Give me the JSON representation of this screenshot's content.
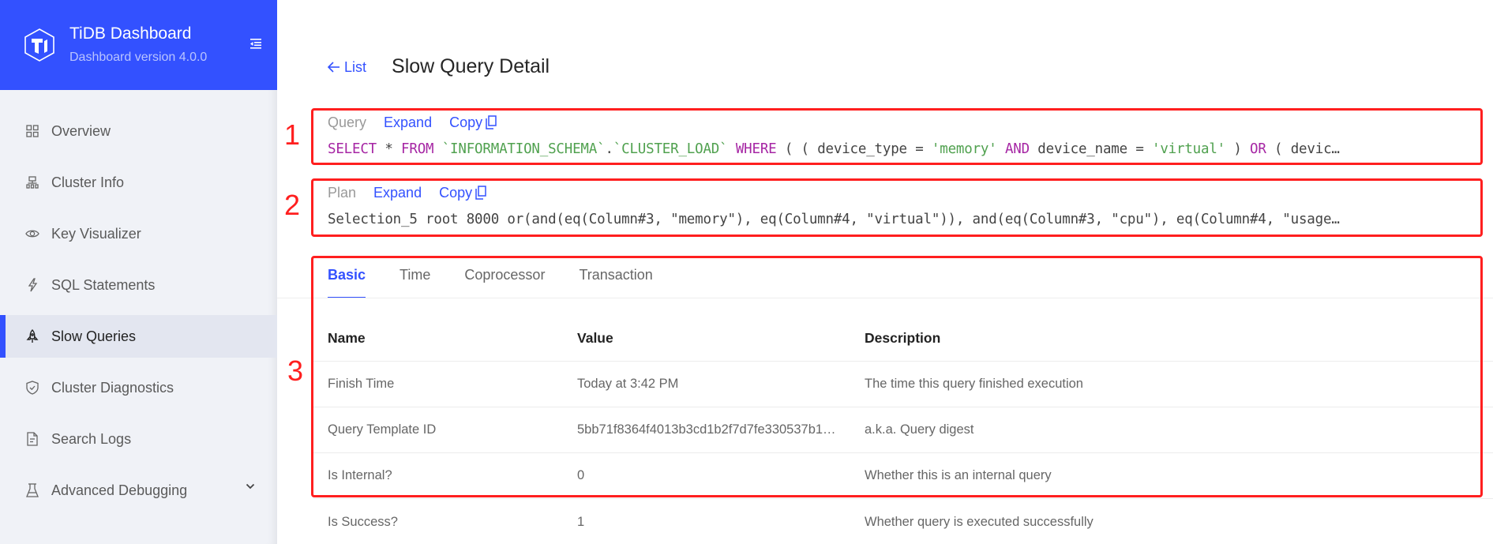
{
  "brand": {
    "title": "TiDB Dashboard",
    "subtitle": "Dashboard version 4.0.0",
    "logo_icon": "tidb-logo-icon",
    "collapse_icon": "menu-fold-icon",
    "color": "#3351ff"
  },
  "sidebar": {
    "items": [
      {
        "label": "Overview",
        "icon": "appstore-icon"
      },
      {
        "label": "Cluster Info",
        "icon": "cluster-icon"
      },
      {
        "label": "Key Visualizer",
        "icon": "eye-icon"
      },
      {
        "label": "SQL Statements",
        "icon": "thunderbolt-icon"
      },
      {
        "label": "Slow Queries",
        "icon": "rocket-icon",
        "active": true
      },
      {
        "label": "Cluster Diagnostics",
        "icon": "safety-icon"
      },
      {
        "label": "Search Logs",
        "icon": "file-text-icon"
      },
      {
        "label": "Advanced Debugging",
        "icon": "experiment-icon",
        "expandable": true
      }
    ]
  },
  "header": {
    "back_label": "List",
    "title": "Slow Query Detail"
  },
  "query": {
    "label": "Query",
    "expand_label": "Expand",
    "copy_label": "Copy",
    "tokens": [
      {
        "t": "SELECT",
        "c": "kw"
      },
      {
        "t": " * "
      },
      {
        "t": "FROM",
        "c": "kw"
      },
      {
        "t": " "
      },
      {
        "t": "`INFORMATION_SCHEMA`",
        "c": "str"
      },
      {
        "t": "."
      },
      {
        "t": "`CLUSTER_LOAD`",
        "c": "str"
      },
      {
        "t": " "
      },
      {
        "t": "WHERE",
        "c": "kw"
      },
      {
        "t": " ( ( device_type = "
      },
      {
        "t": "'memory'",
        "c": "str"
      },
      {
        "t": " "
      },
      {
        "t": "AND",
        "c": "kw"
      },
      {
        "t": " device_name = "
      },
      {
        "t": "'virtual'",
        "c": "str"
      },
      {
        "t": " ) "
      },
      {
        "t": "OR",
        "c": "kw"
      },
      {
        "t": " ( devic…"
      }
    ]
  },
  "plan": {
    "label": "Plan",
    "expand_label": "Expand",
    "copy_label": "Copy",
    "text": "Selection_5 root 8000 or(and(eq(Column#3, \"memory\"), eq(Column#4, \"virtual\")), and(eq(Column#3, \"cpu\"), eq(Column#4, \"usage…"
  },
  "tabs": [
    {
      "label": "Basic",
      "active": true
    },
    {
      "label": "Time"
    },
    {
      "label": "Coprocessor"
    },
    {
      "label": "Transaction"
    }
  ],
  "table": {
    "columns": [
      "Name",
      "Value",
      "Description"
    ],
    "rows": [
      [
        "Finish Time",
        "Today at 3:42 PM",
        "The time this query finished execution"
      ],
      [
        "Query Template ID",
        "5bb71f8364f4013b3cd1b2f7d7fe330537b1…",
        "a.k.a. Query digest"
      ],
      [
        "Is Internal?",
        "0",
        "Whether this is an internal query"
      ],
      [
        "Is Success?",
        "1",
        "Whether query is executed successfully"
      ]
    ]
  },
  "annotations": [
    {
      "number": "1"
    },
    {
      "number": "2"
    },
    {
      "number": "3"
    }
  ]
}
